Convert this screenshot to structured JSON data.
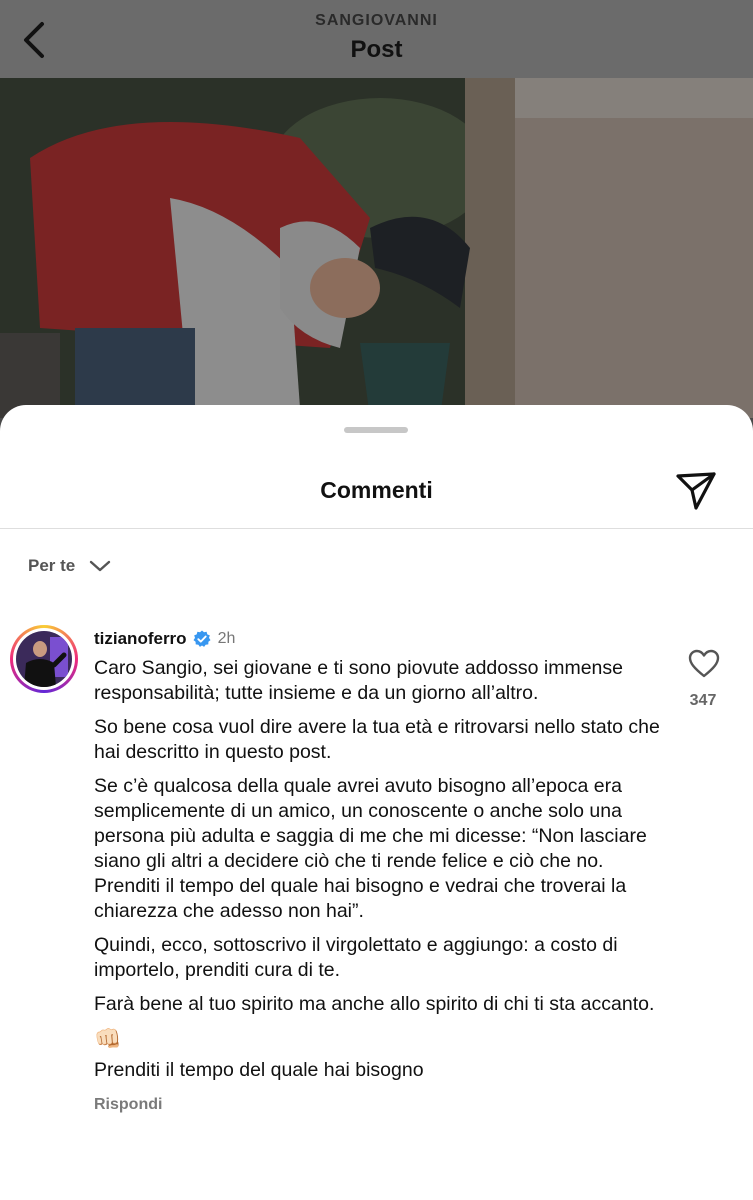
{
  "header": {
    "account_name": "SANGIOVANNI",
    "title": "Post",
    "back_icon": "chevron-left-icon"
  },
  "sheet": {
    "title": "Commenti",
    "share_icon": "paper-plane-icon",
    "filter_label": "Per te",
    "filter_icon": "chevron-down-icon"
  },
  "comment": {
    "username": "tizianoferro",
    "verified_icon": "verified-badge-icon",
    "verified_color": "#3897f0",
    "time": "2h",
    "paragraphs": [
      "Caro Sangio, sei giovane e ti sono piovute addosso immense responsabilità; tutte insieme e da un giorno all’altro.",
      "So bene cosa vuol dire avere la tua età e ritrovarsi nello stato che hai descritto in questo post.",
      "Se c’è qualcosa della quale avrei avuto bisogno all’epoca era semplicemente di un amico, un conoscente o anche solo una persona più adulta e saggia di me che mi dicesse: “Non lasciare siano gli altri a decidere ciò che ti rende felice e ciò che no. Prenditi il tempo del quale hai bisogno e vedrai che troverai la chiarezza che adesso non hai”.",
      "Quindi, ecco, sottoscrivo il virgolettato e aggiungo: a costo di importelo, prenditi cura di te.",
      "Farà bene al tuo spirito ma anche allo spirito di chi ti sta accanto."
    ],
    "emoji": "👊🏻",
    "closing": "Prenditi il tempo del quale hai bisogno",
    "reply_label": "Rispondi",
    "like_icon": "heart-outline-icon",
    "like_count": "347"
  }
}
